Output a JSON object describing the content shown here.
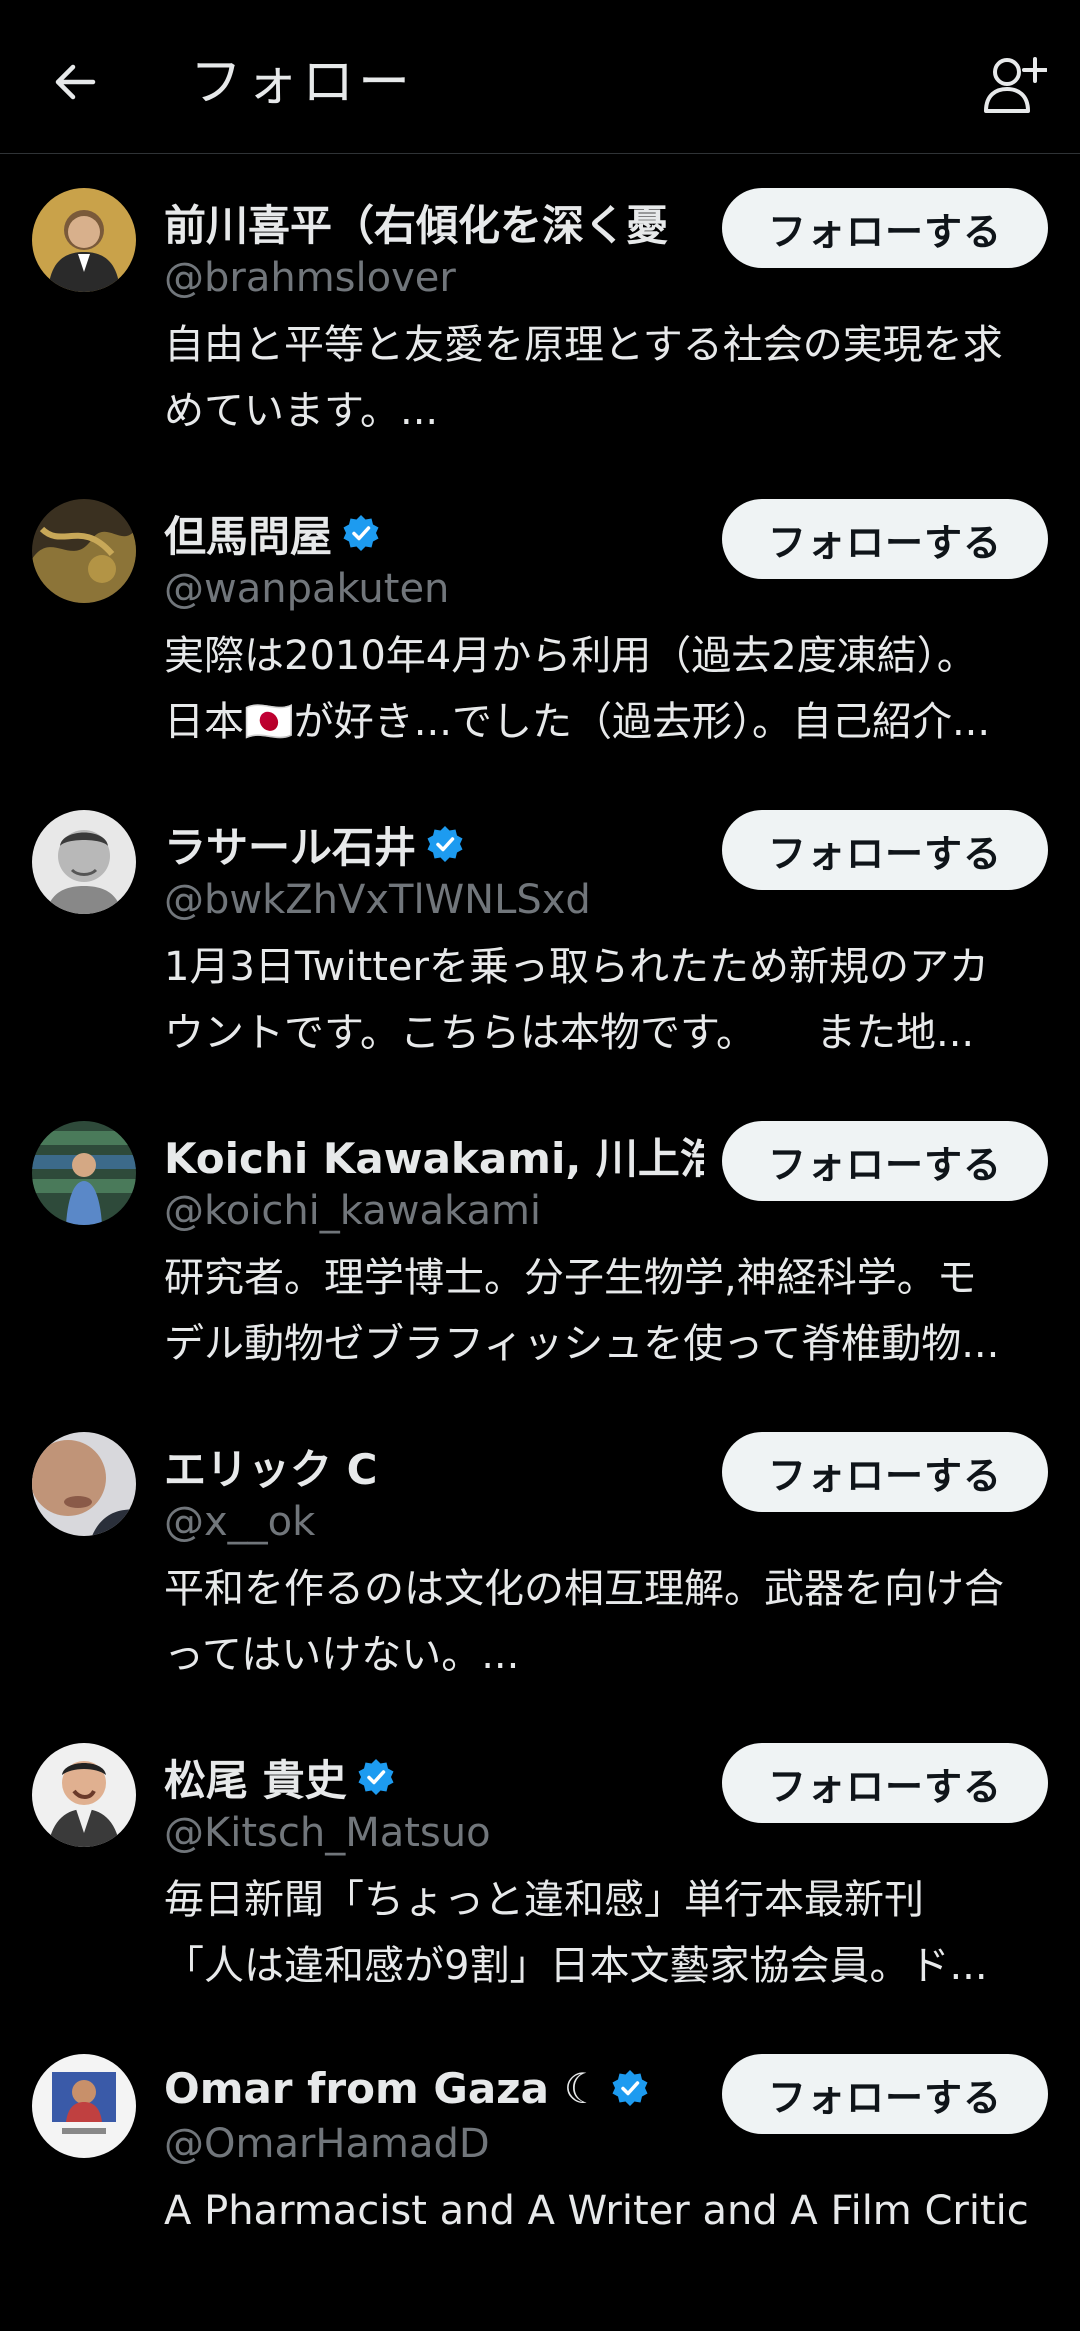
{
  "header": {
    "title": "フォロー",
    "back_icon": "arrow-left-icon",
    "add_icon": "add-user-icon"
  },
  "colors": {
    "background": "#000000",
    "text": "#e7e9ea",
    "secondary": "#71767b",
    "verified": "#1d9bf0",
    "button_bg": "#eff3f4",
    "button_text": "#0f1419"
  },
  "users": [
    {
      "name": "前川喜平（右傾化を深く憂",
      "verified": false,
      "handle": "@brahmslover",
      "bio": [
        "自由と平等と友愛を原理とする社会の実現を求",
        "めています。..."
      ],
      "button": "フォローする"
    },
    {
      "name": "但馬問屋",
      "verified": true,
      "handle": "@wanpakuten",
      "bio": [
        "実際は2010年4月から利用（過去2度凍結）。",
        "日本🇯🇵が好き...でした（過去形）。自己紹介..."
      ],
      "button": "フォローする"
    },
    {
      "name": "ラサール石井",
      "verified": true,
      "handle": "@bwkZhVxTlWNLSxd",
      "bio": [
        "1月3日Twitterを乗っ取られたため新規のアカ",
        "ウントです。こちらは本物です。　　また地..."
      ],
      "button": "フォローする"
    },
    {
      "name": "Koichi Kawakami, 川上浩一",
      "verified": false,
      "handle": "@koichi_kawakami",
      "bio": [
        "研究者。理学博士。分子生物学,神経科学。モ",
        "デル動物ゼブラフィッシュを使って脊椎動物..."
      ],
      "button": "フォローする"
    },
    {
      "name": "エリック C",
      "verified": false,
      "handle": "@x__ok",
      "bio": [
        "平和を作るのは文化の相互理解。武器を向け合",
        "ってはいけない。..."
      ],
      "button": "フォローする"
    },
    {
      "name": "松尾 貴史",
      "verified": true,
      "handle": "@Kitsch_Matsuo",
      "bio": [
        "毎日新聞「ちょっと違和感」単行本最新刊",
        "「人は違和感が9割」日本文藝家協会員。ド..."
      ],
      "button": "フォローする"
    },
    {
      "name": "Omar from Gaza ☾",
      "verified": true,
      "handle": "@OmarHamadD",
      "bio": [
        "A Pharmacist and A Writer and A Film Critic",
        ""
      ],
      "button": "フォローする"
    }
  ]
}
